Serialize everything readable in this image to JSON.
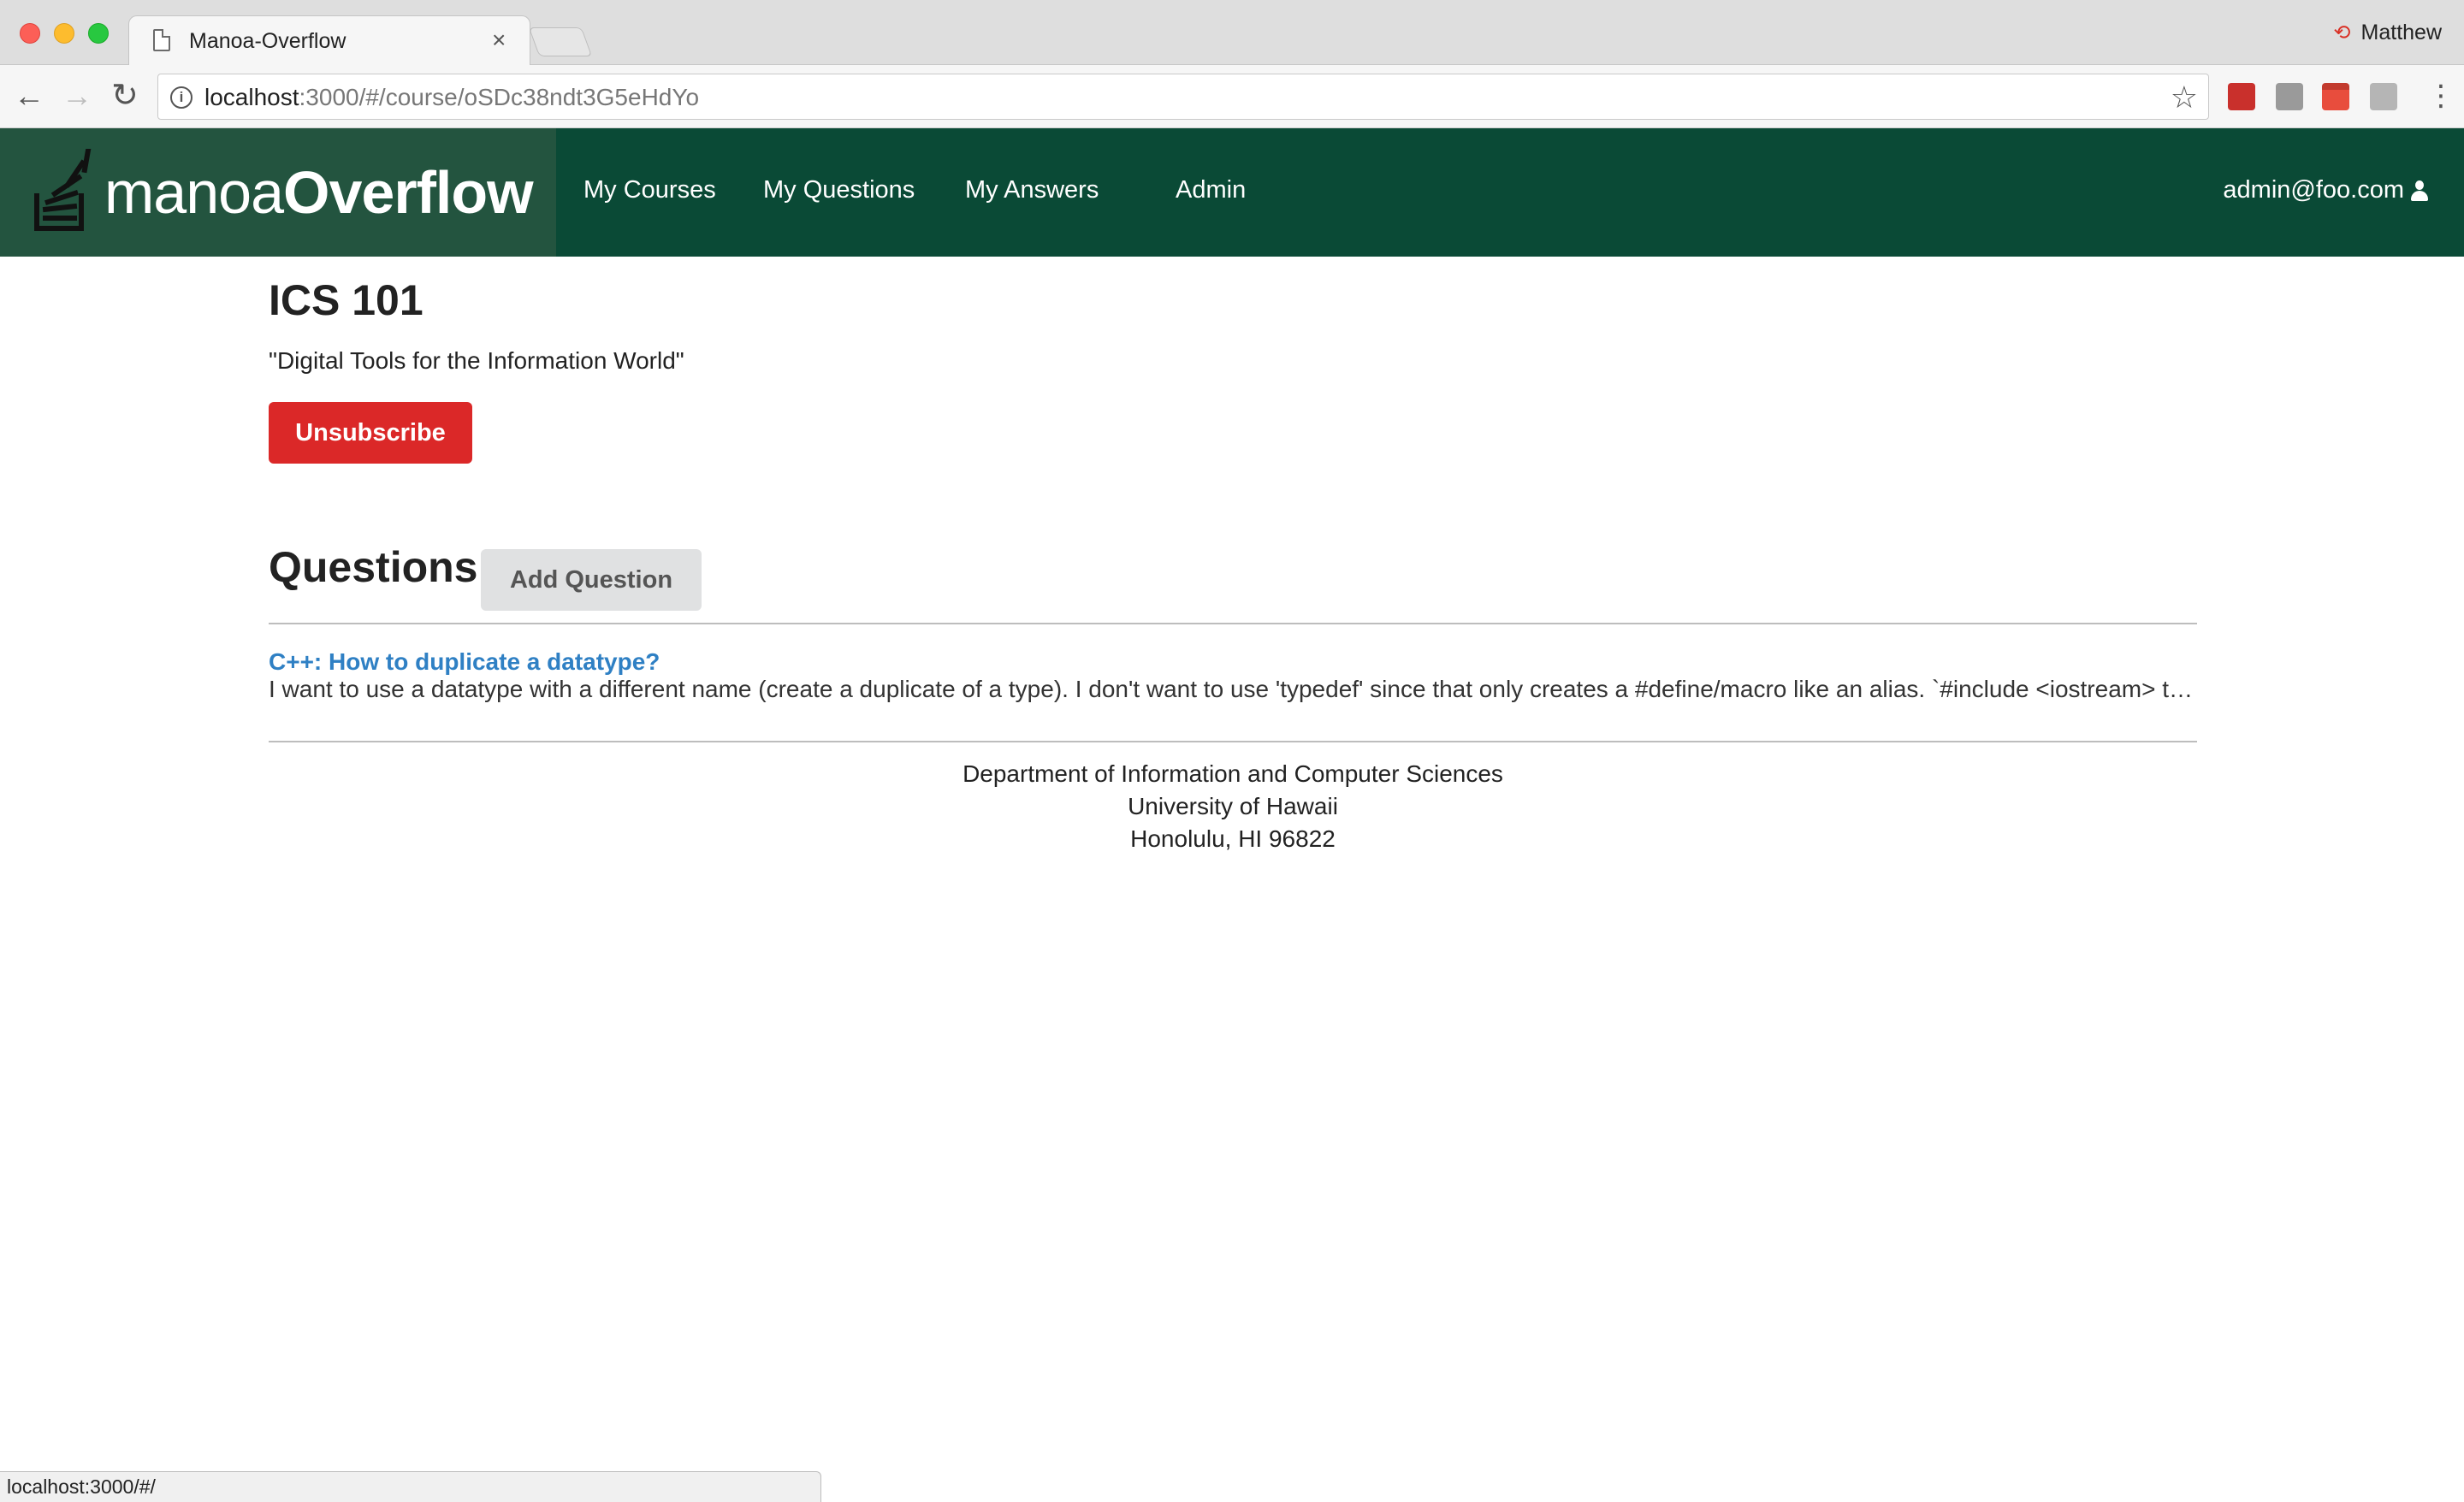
{
  "browser": {
    "tab_title": "Manoa-Overflow",
    "tab_close": "×",
    "profile_name": "Matthew",
    "url_host": "localhost",
    "url_path": ":3000/#/course/oSDc38ndt3G5eHdYo",
    "status_url": "localhost:3000/#/"
  },
  "navbar": {
    "brand_light": "manoa",
    "brand_bold": "Overflow",
    "links": {
      "my_courses": "My Courses",
      "my_questions": "My Questions",
      "my_answers": "My Answers",
      "admin": "Admin"
    },
    "user_email": "admin@foo.com"
  },
  "course": {
    "title": "ICS 101",
    "description": "\"Digital Tools for the Information World\"",
    "unsubscribe_label": "Unsubscribe"
  },
  "questions": {
    "header": "Questions",
    "add_label": "Add Question",
    "items": [
      {
        "title": "C++: How to duplicate a datatype?",
        "body": "I want to use a datatype with a different name (create a duplicate of a type). I don't want to use 'typedef' since that only creates a #define/macro like an alias. `#include <iostream> typed..."
      }
    ]
  },
  "footer": {
    "line1": "Department of Information and Computer Sciences",
    "line2": "University of Hawaii",
    "line3": "Honolulu, HI 96822"
  },
  "colors": {
    "navbar": "#0a4a36",
    "brand_bg": "#23543f",
    "danger": "#db2828",
    "link": "#2f80c4"
  }
}
